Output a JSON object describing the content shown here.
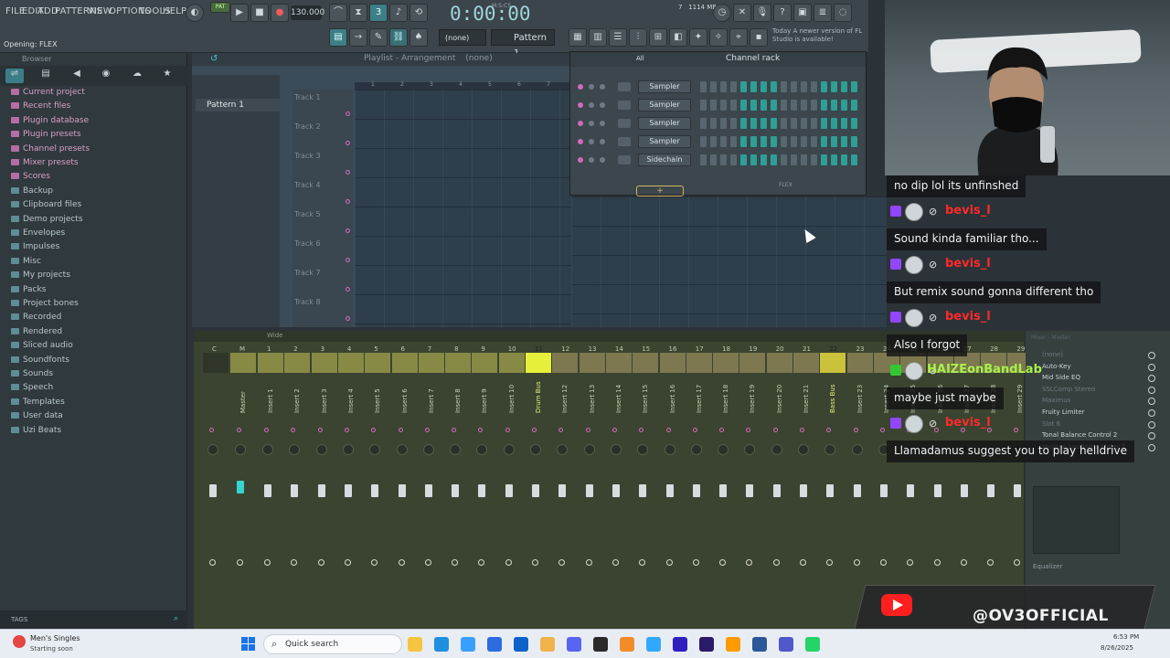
{
  "menu": [
    "FILE",
    "EDIT",
    "ADD",
    "PATTERNS",
    "VIEW",
    "OPTIONS",
    "TOOLS",
    "HELP"
  ],
  "toolbar": {
    "pat_label": "PAT",
    "tempo": "130.000",
    "time": "0:00:00",
    "time_label": "M:S:CS",
    "memory": "1114 MB",
    "cpu_count": "7",
    "pattern_select": "Pattern 1",
    "none_select": "(none)",
    "hint_line": "Opening: FLEX",
    "version_note": "Today  A newer version of FL Studio is available!"
  },
  "browser": {
    "title": "Browser",
    "tabs": [
      "all-tab",
      "project-tab",
      "audio-tab",
      "plugin-tab",
      "cloud-tab",
      "star-tab"
    ],
    "items": [
      {
        "label": "Current project",
        "style": "pink"
      },
      {
        "label": "Recent files",
        "style": "pink"
      },
      {
        "label": "Plugin database",
        "style": "pink"
      },
      {
        "label": "Plugin presets",
        "style": "pink"
      },
      {
        "label": "Channel presets",
        "style": "pink"
      },
      {
        "label": "Mixer presets",
        "style": "pink"
      },
      {
        "label": "Scores",
        "style": "pink"
      },
      {
        "label": "Backup",
        "style": "normal"
      },
      {
        "label": "Clipboard files",
        "style": "normal"
      },
      {
        "label": "Demo projects",
        "style": "normal"
      },
      {
        "label": "Envelopes",
        "style": "normal"
      },
      {
        "label": "Impulses",
        "style": "normal"
      },
      {
        "label": "Misc",
        "style": "normal"
      },
      {
        "label": "My projects",
        "style": "normal"
      },
      {
        "label": "Packs",
        "style": "normal"
      },
      {
        "label": "Project bones",
        "style": "normal"
      },
      {
        "label": "Recorded",
        "style": "normal"
      },
      {
        "label": "Rendered",
        "style": "normal"
      },
      {
        "label": "Sliced audio",
        "style": "normal"
      },
      {
        "label": "Soundfonts",
        "style": "normal"
      },
      {
        "label": "Sounds",
        "style": "normal"
      },
      {
        "label": "Speech",
        "style": "normal"
      },
      {
        "label": "Templates",
        "style": "normal"
      },
      {
        "label": "User data",
        "style": "normal"
      },
      {
        "label": "Uzi Beats",
        "style": "normal"
      }
    ],
    "tags_label": "TAGS"
  },
  "playlist": {
    "title": "Playlist - Arrangement",
    "arrangement_value": "(none)",
    "pattern": "Pattern 1",
    "tracks": [
      "Track 1",
      "Track 2",
      "Track 3",
      "Track 4",
      "Track 5",
      "Track 6",
      "Track 7",
      "Track 8"
    ],
    "ruler": [
      "1",
      "2",
      "3",
      "4",
      "5",
      "6",
      "7"
    ]
  },
  "channel_rack": {
    "title": "Channel rack",
    "filter": "All",
    "channels": [
      "Sampler",
      "Sampler",
      "Sampler",
      "Sampler",
      "Sidechain"
    ],
    "add_label": "+",
    "flex_label": "FLEX"
  },
  "mixer": {
    "view_mode": "Wide",
    "strips": [
      {
        "num": "C",
        "name": ""
      },
      {
        "num": "M",
        "name": "Master"
      },
      {
        "num": "1",
        "name": "Insert 1"
      },
      {
        "num": "2",
        "name": "Insert 2"
      },
      {
        "num": "3",
        "name": "Insert 3"
      },
      {
        "num": "4",
        "name": "Insert 4"
      },
      {
        "num": "5",
        "name": "Insert 5"
      },
      {
        "num": "6",
        "name": "Insert 6"
      },
      {
        "num": "7",
        "name": "Insert 7"
      },
      {
        "num": "8",
        "name": "Insert 8"
      },
      {
        "num": "9",
        "name": "Insert 9"
      },
      {
        "num": "10",
        "name": "Insert 10"
      },
      {
        "num": "11",
        "name": "Drum Bus"
      },
      {
        "num": "12",
        "name": "Insert 12"
      },
      {
        "num": "13",
        "name": "Insert 13"
      },
      {
        "num": "14",
        "name": "Insert 14"
      },
      {
        "num": "15",
        "name": "Insert 15"
      },
      {
        "num": "16",
        "name": "Insert 16"
      },
      {
        "num": "17",
        "name": "Insert 17"
      },
      {
        "num": "18",
        "name": "Insert 18"
      },
      {
        "num": "19",
        "name": "Insert 19"
      },
      {
        "num": "20",
        "name": "Insert 20"
      },
      {
        "num": "21",
        "name": "Insert 21"
      },
      {
        "num": "22",
        "name": "Bass Bus"
      },
      {
        "num": "23",
        "name": "Insert 23"
      },
      {
        "num": "24",
        "name": "Insert 24"
      },
      {
        "num": "25",
        "name": "Insert 25"
      },
      {
        "num": "26",
        "name": "Insert 26"
      },
      {
        "num": "27",
        "name": "Insert 27"
      },
      {
        "num": "28",
        "name": "Insert 28"
      },
      {
        "num": "29",
        "name": "Insert 29"
      }
    ],
    "inserts_title": "Mixer - Master",
    "inserts": [
      {
        "label": "(none)",
        "dim": true
      },
      {
        "label": "Auto-Key",
        "dim": false
      },
      {
        "label": "Mid Side EQ",
        "dim": false
      },
      {
        "label": "SSLComp Stereo",
        "dim": true
      },
      {
        "label": "Maximus",
        "dim": true
      },
      {
        "label": "Fruity Limiter",
        "dim": false
      },
      {
        "label": "Slot 6",
        "dim": true
      },
      {
        "label": "Tonal Balance Control 2",
        "dim": false
      },
      {
        "label": "Youlean Loudness Meter 2",
        "dim": false
      }
    ],
    "eq_label": "Equalizer"
  },
  "chat": [
    {
      "type": "message",
      "text": "no dip lol its unfinshed"
    },
    {
      "type": "header",
      "user": "bevis_l",
      "color": "red"
    },
    {
      "type": "message",
      "text": "Sound kinda familiar tho..."
    },
    {
      "type": "header",
      "user": "bevis_l",
      "color": "red"
    },
    {
      "type": "message",
      "text": "But remix sound gonna different tho"
    },
    {
      "type": "header",
      "user": "bevis_l",
      "color": "red"
    },
    {
      "type": "message",
      "text": "Also I forgot"
    },
    {
      "type": "header",
      "user": "HAIZEonBandLab",
      "color": "green"
    },
    {
      "type": "message",
      "text": "maybe just maybe"
    },
    {
      "type": "header",
      "user": "bevis_l",
      "color": "red"
    },
    {
      "type": "message",
      "text": "Llamadamus suggest you to play helldrive"
    }
  ],
  "youtube": {
    "handle": "@OV3OFFICIAL"
  },
  "taskbar": {
    "weather_title": "Men's Singles",
    "weather_sub": "Starting soon",
    "search_placeholder": "Quick search",
    "clock_time": "6:53 PM",
    "clock_date": "8/26/2025",
    "apps": [
      "file-explorer-app",
      "edge-app",
      "chrome-app",
      "store-app",
      "outlook-app",
      "folder-app",
      "discord-app",
      "obs-app",
      "fl-studio-app",
      "photoshop-app",
      "premiere-app",
      "after-effects-app",
      "illustrator-app",
      "word-app",
      "teams-app",
      "whatsapp-app"
    ]
  }
}
